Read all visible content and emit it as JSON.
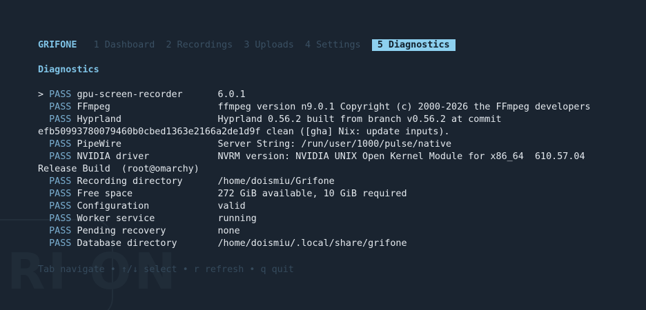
{
  "app": {
    "brand": "GRIFONE",
    "watermark": "RI ON"
  },
  "tabs": [
    {
      "label": "1 Dashboard"
    },
    {
      "label": "2 Recordings"
    },
    {
      "label": "3 Uploads"
    },
    {
      "label": "4 Settings"
    },
    {
      "label": "5 Diagnostics",
      "active": true
    }
  ],
  "section_title": "Diagnostics",
  "cursor": ">",
  "checks": [
    {
      "status": "PASS",
      "name": "gpu-screen-recorder",
      "value": "6.0.1"
    },
    {
      "status": "PASS",
      "name": "FFmpeg",
      "value": "ffmpeg version n9.0.1 Copyright (c) 2000-2026 the FFmpeg developers"
    },
    {
      "status": "PASS",
      "name": "Hyprland",
      "value": "Hyprland 0.56.2 built from branch v0.56.2 at commit",
      "wrap": "efb50993780079460b0cbed1363e2166a2de1d9f clean ([gha] Nix: update inputs)."
    },
    {
      "status": "PASS",
      "name": "PipeWire",
      "value": "Server String: /run/user/1000/pulse/native"
    },
    {
      "status": "PASS",
      "name": "NVIDIA driver",
      "value": "NVRM version: NVIDIA UNIX Open Kernel Module for x86_64  610.57.04",
      "wrap": "Release Build  (root@omarchy)"
    },
    {
      "status": "PASS",
      "name": "Recording directory",
      "value": "/home/doismiu/Grifone"
    },
    {
      "status": "PASS",
      "name": "Free space",
      "value": "272 GiB available, 10 GiB required"
    },
    {
      "status": "PASS",
      "name": "Configuration",
      "value": "valid"
    },
    {
      "status": "PASS",
      "name": "Worker service",
      "value": "running"
    },
    {
      "status": "PASS",
      "name": "Pending recovery",
      "value": "none"
    },
    {
      "status": "PASS",
      "name": "Database directory",
      "value": "/home/doismiu/.local/share/grifone"
    }
  ],
  "footer": "Tab navigate • ↑/↓ select • r refresh • q quit",
  "colors": {
    "background": "#1a2430",
    "accent": "#7fc3e6",
    "active_tab_bg": "#8dd0ef",
    "pass": "#7aaed0",
    "dim": "#3a5063"
  }
}
